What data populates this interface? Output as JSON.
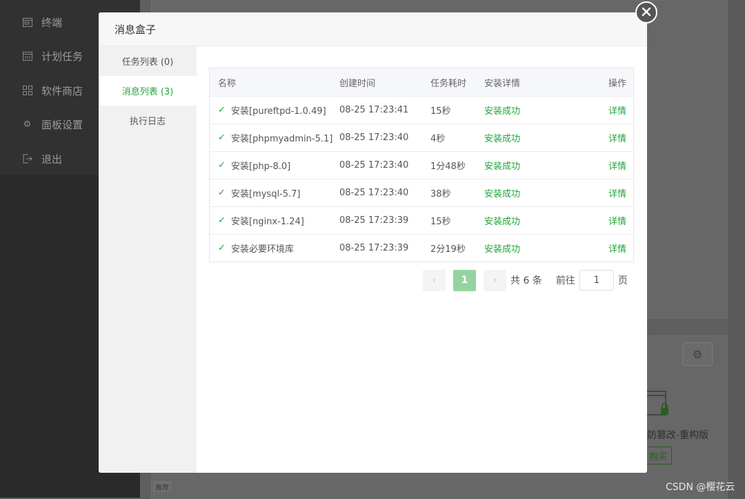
{
  "sidebar": {
    "items": [
      {
        "label": "终端",
        "icon": "terminal-icon"
      },
      {
        "label": "计划任务",
        "icon": "calendar-icon"
      },
      {
        "label": "软件商店",
        "icon": "grid-icon"
      },
      {
        "label": "面板设置",
        "icon": "gear-icon"
      },
      {
        "label": "退出",
        "icon": "logout-icon"
      }
    ]
  },
  "background": {
    "product_name": "防篡改-重构版",
    "buy_label": "购买",
    "tag": "推荐"
  },
  "watermark": "CSDN @樱花云",
  "modal": {
    "title": "消息盒子",
    "tabs": [
      {
        "label": "任务列表 (0)",
        "active": false
      },
      {
        "label": "消息列表 (3)",
        "active": true
      },
      {
        "label": "执行日志",
        "active": false
      }
    ],
    "table": {
      "headers": [
        "名称",
        "创建时间",
        "任务耗时",
        "安装详情",
        "操作"
      ],
      "rows": [
        {
          "name": "安装[pureftpd-1.0.49]",
          "time": "08-25 17:23:41",
          "duration": "15秒",
          "status": "安装成功",
          "action": "详情"
        },
        {
          "name": "安装[phpmyadmin-5.1]",
          "time": "08-25 17:23:40",
          "duration": "4秒",
          "status": "安装成功",
          "action": "详情"
        },
        {
          "name": "安装[php-8.0]",
          "time": "08-25 17:23:40",
          "duration": "1分48秒",
          "status": "安装成功",
          "action": "详情"
        },
        {
          "name": "安装[mysql-5.7]",
          "time": "08-25 17:23:40",
          "duration": "38秒",
          "status": "安装成功",
          "action": "详情"
        },
        {
          "name": "安装[nginx-1.24]",
          "time": "08-25 17:23:39",
          "duration": "15秒",
          "status": "安装成功",
          "action": "详情"
        },
        {
          "name": "安装必要环境库",
          "time": "08-25 17:23:39",
          "duration": "2分19秒",
          "status": "安装成功",
          "action": "详情"
        }
      ]
    },
    "pagination": {
      "current_page": "1",
      "total": "共 6 条",
      "goto_label": "前往",
      "goto_value": "1",
      "page_suffix": "页"
    }
  },
  "colors": {
    "accent": "#20a53a",
    "page_active": "#95d4a1"
  }
}
